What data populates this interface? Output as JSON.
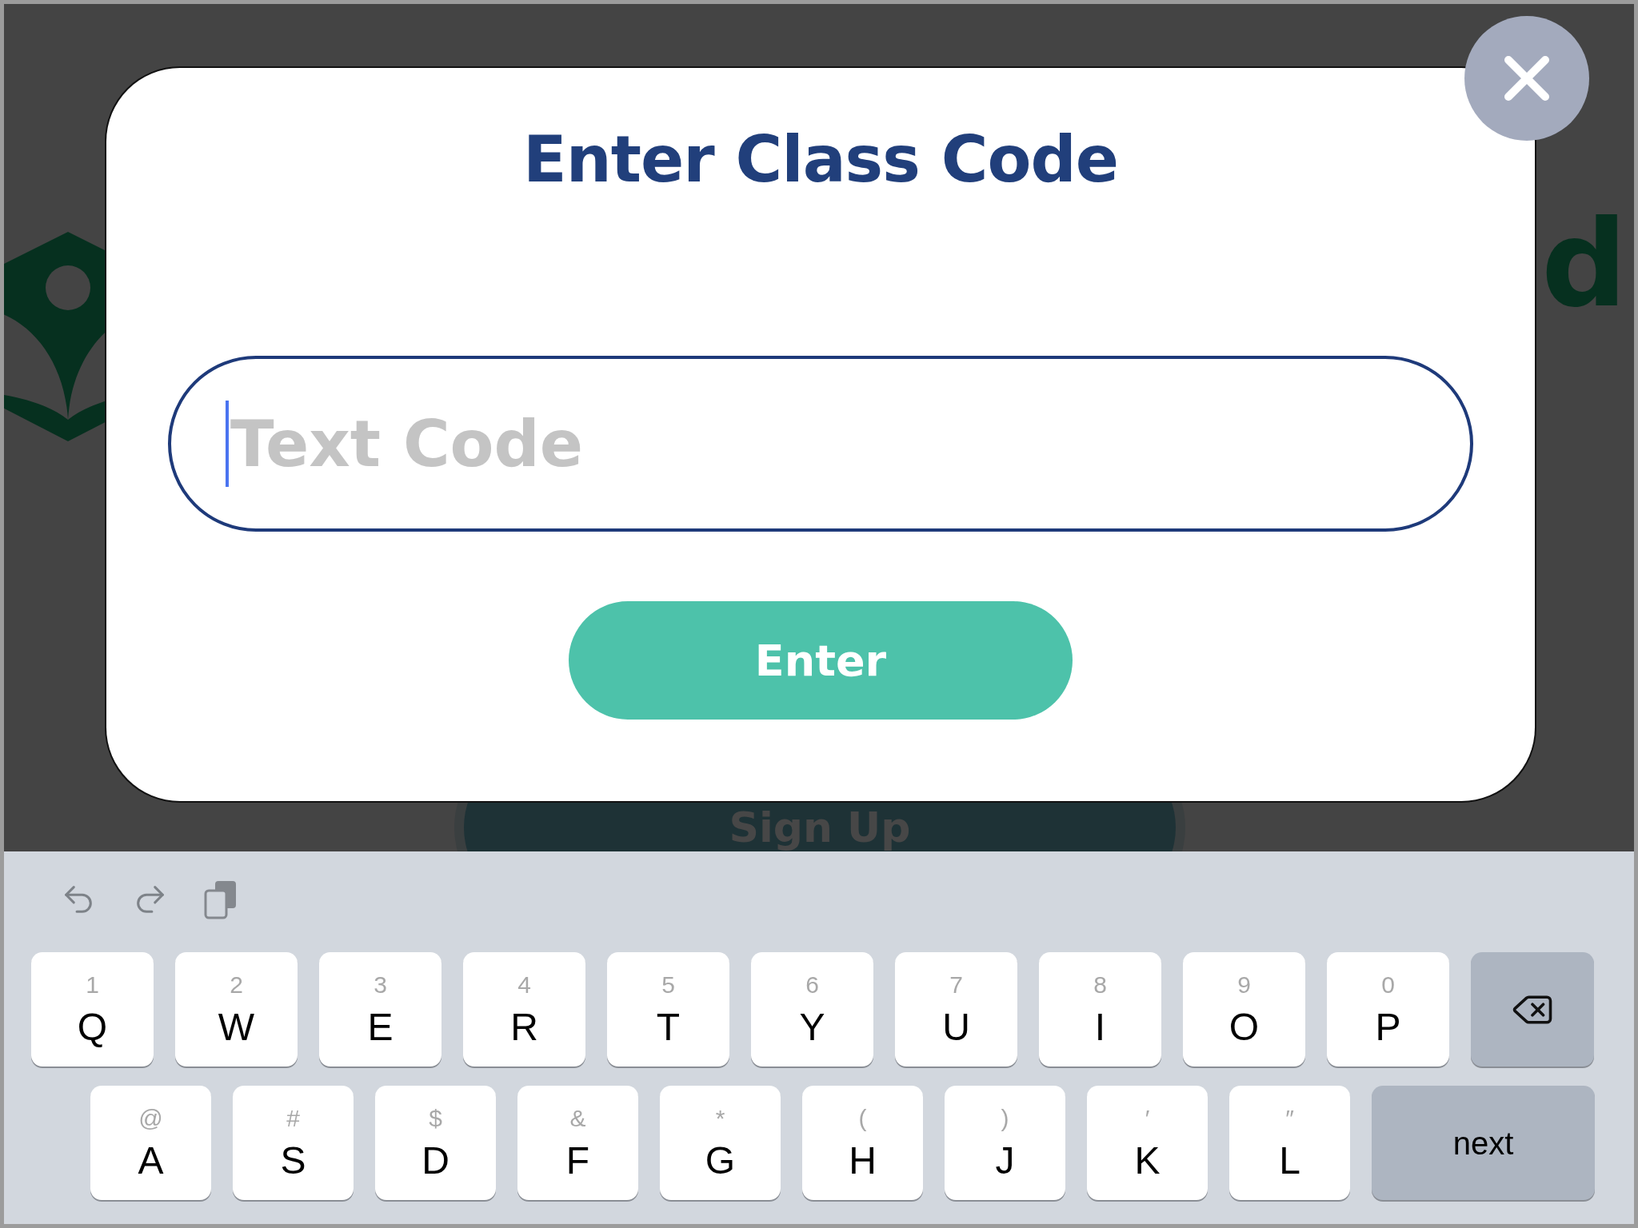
{
  "background": {
    "logo_text": "d",
    "button": "Sign Up"
  },
  "dialog": {
    "title": "Enter Class Code",
    "field": {
      "placeholder": "Text Code",
      "focused": true
    },
    "button": "Enter"
  },
  "keyboard": {
    "rows": [
      {
        "keys": [
          {
            "kind": "letter",
            "label": "Q",
            "hint": "1"
          },
          {
            "kind": "letter",
            "label": "W",
            "hint": "2"
          },
          {
            "kind": "letter",
            "label": "E",
            "hint": "3"
          },
          {
            "kind": "letter",
            "label": "R",
            "hint": "4"
          },
          {
            "kind": "letter",
            "label": "T",
            "hint": "5"
          },
          {
            "kind": "letter",
            "label": "Y",
            "hint": "6"
          },
          {
            "kind": "letter",
            "label": "U",
            "hint": "7"
          },
          {
            "kind": "letter",
            "label": "I",
            "hint": "8"
          },
          {
            "kind": "letter",
            "label": "O",
            "hint": "9"
          },
          {
            "kind": "letter",
            "label": "P",
            "hint": "0"
          },
          {
            "kind": "delete"
          }
        ]
      },
      {
        "keys": [
          {
            "kind": "letter",
            "label": "A",
            "hint": "@"
          },
          {
            "kind": "letter",
            "label": "S",
            "hint": "#"
          },
          {
            "kind": "letter",
            "label": "D",
            "hint": "$"
          },
          {
            "kind": "letter",
            "label": "F",
            "hint": "&"
          },
          {
            "kind": "letter",
            "label": "G",
            "hint": "*"
          },
          {
            "kind": "letter",
            "label": "H",
            "hint": "("
          },
          {
            "kind": "letter",
            "label": "J",
            "hint": ")"
          },
          {
            "kind": "letter",
            "label": "K",
            "hint": "′"
          },
          {
            "kind": "letter",
            "label": "L",
            "hint": "″"
          },
          {
            "kind": "action",
            "label": "next"
          }
        ]
      }
    ]
  }
}
